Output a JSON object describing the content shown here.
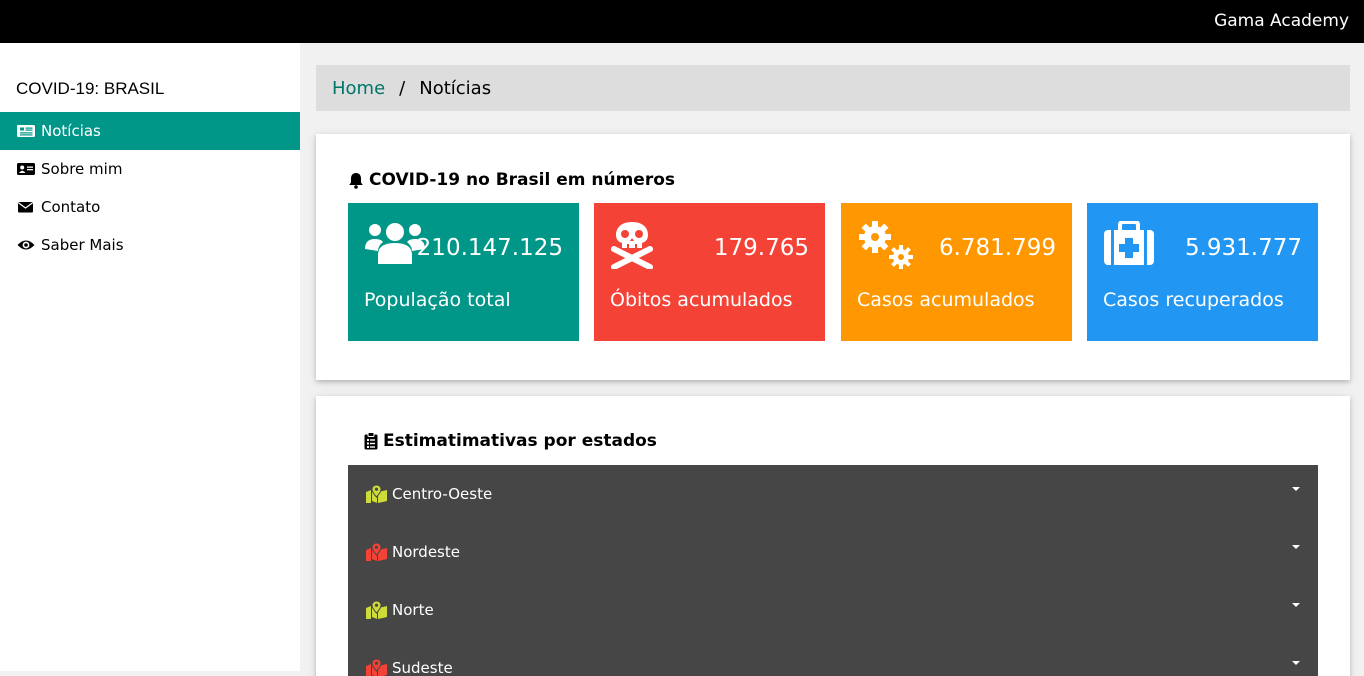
{
  "header": {
    "brand": "Gama Academy",
    "bg": "#000000"
  },
  "sidebar": {
    "title": "COVID-19: BRASIL",
    "items": [
      {
        "label": "Notícias",
        "icon": "newspaper-icon",
        "active": true
      },
      {
        "label": "Sobre mim",
        "icon": "id-card-icon",
        "active": false
      },
      {
        "label": "Contato",
        "icon": "envelope-icon",
        "active": false
      },
      {
        "label": "Saber Mais",
        "icon": "eye-icon",
        "active": false
      }
    ],
    "accent": "#009688"
  },
  "breadcrumb": {
    "home": "Home",
    "separator": "/",
    "current": "Notícias"
  },
  "numbers_card": {
    "title": "COVID-19 no Brasil em números",
    "title_icon": "bell-icon",
    "stats": [
      {
        "value": "210.147.125",
        "label": "População total",
        "icon": "users-icon",
        "color": "#009688"
      },
      {
        "value": "179.765",
        "label": "Óbitos acumulados",
        "icon": "skull-crossbones-icon",
        "color": "#f44336"
      },
      {
        "value": "6.781.799",
        "label": "Casos acumulados",
        "icon": "cogs-icon",
        "color": "#ff9800"
      },
      {
        "value": "5.931.777",
        "label": "Casos recuperados",
        "icon": "medkit-icon",
        "color": "#2196f3"
      }
    ]
  },
  "states_card": {
    "title": "Estimatimativas por estados",
    "title_icon": "clipboard-list-icon",
    "regions": [
      {
        "label": "Centro-Oeste",
        "icon": "map-marked-icon",
        "icon_color": "#cddc39"
      },
      {
        "label": "Nordeste",
        "icon": "map-marked-icon",
        "icon_color": "#f44336"
      },
      {
        "label": "Norte",
        "icon": "map-marked-icon",
        "icon_color": "#cddc39"
      },
      {
        "label": "Sudeste",
        "icon": "map-marked-icon",
        "icon_color": "#f44336"
      }
    ]
  }
}
